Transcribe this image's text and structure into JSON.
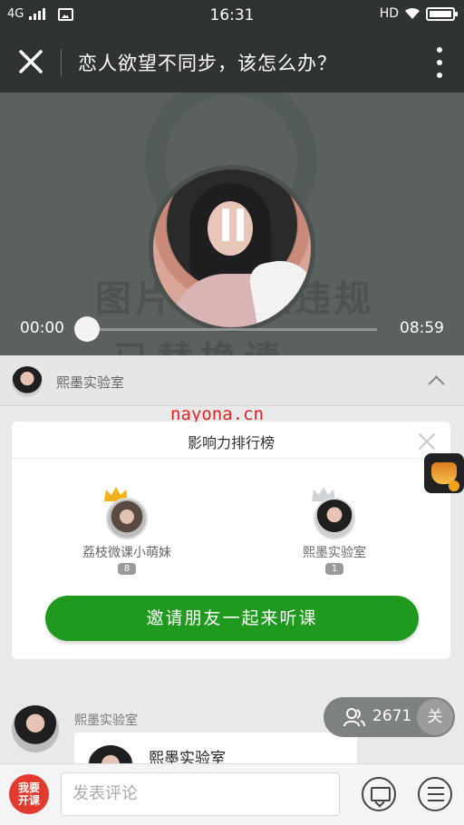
{
  "status_bar": {
    "network": "4G",
    "time": "16:31",
    "hd": "HD"
  },
  "header": {
    "title": "恋人欲望不同步，该怎么办？"
  },
  "player": {
    "bg_text_line1": "图片被屏蔽违规",
    "bg_text_line2": "已替换请",
    "current_time": "00:00",
    "total_time": "08:59",
    "progress": 0
  },
  "lecturer": {
    "name": "熙墨实验室"
  },
  "watermark": "nayona.cn",
  "ranking": {
    "title": "影响力排行榜",
    "items": [
      {
        "name": "荔枝微课小萌妹",
        "count": "8"
      },
      {
        "name": "熙墨实验室",
        "count": "1"
      }
    ],
    "invite_label": "邀请朋友一起来听课"
  },
  "message": {
    "sender": "熙墨实验室",
    "card_title": "熙墨实验室"
  },
  "listeners": {
    "count": "2671",
    "follow_label": "关"
  },
  "bottom_bar": {
    "open_course_label_1": "我要",
    "open_course_label_2": "开课",
    "comment_placeholder": "发表评论"
  },
  "colors": {
    "accent_green": "#1f9a1f",
    "header_bg": "#2f3331",
    "open_course_red": "#e23a2e"
  }
}
